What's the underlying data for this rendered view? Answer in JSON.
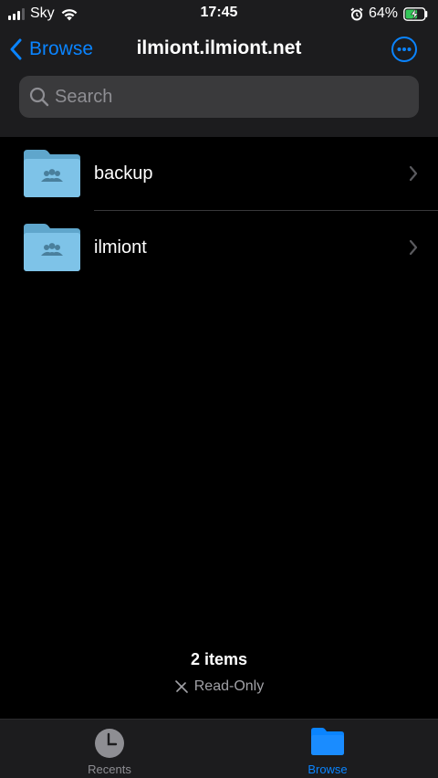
{
  "status_bar": {
    "carrier": "Sky",
    "time": "17:45",
    "battery_percent": "64%",
    "icons": [
      "signal-icon",
      "wifi-icon",
      "alarm-icon",
      "battery-charging-icon"
    ]
  },
  "nav": {
    "back_label": "Browse",
    "title": "ilmiont.ilmiont.net",
    "more_icon": "ellipsis-circle-icon"
  },
  "search": {
    "placeholder": "Search"
  },
  "files": [
    {
      "name": "backup",
      "icon": "shared-folder-icon"
    },
    {
      "name": "ilmiont",
      "icon": "shared-folder-icon"
    }
  ],
  "footer": {
    "item_count": "2 items",
    "read_only": "Read-Only"
  },
  "tabs": [
    {
      "label": "Recents",
      "icon": "clock-icon",
      "selected": false
    },
    {
      "label": "Browse",
      "icon": "folder-icon",
      "selected": true
    }
  ],
  "colors": {
    "accent": "#0a84ff",
    "bar_background": "#1c1c1e",
    "background": "#000000",
    "folder": "#7ec3e8"
  }
}
